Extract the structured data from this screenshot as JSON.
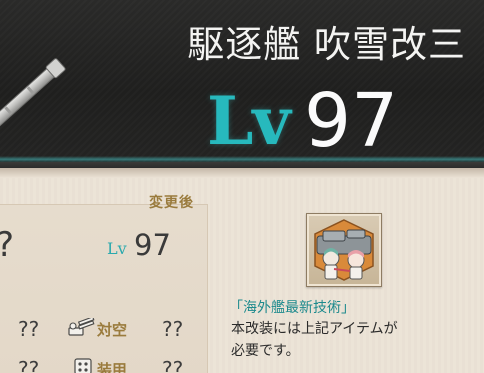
{
  "header": {
    "ship_title": "駆逐艦 吹雪改三",
    "level_prefix": "Lv",
    "level_value": "97"
  },
  "card": {
    "after_label": "変更後",
    "unknown_name": "?",
    "level_prefix": "Lv",
    "level_value": "97",
    "stats": [
      {
        "left_value": "??",
        "name": "対空",
        "right_value": "??",
        "icon": "anti-air-gun-icon"
      },
      {
        "left_value": "??",
        "name": "装甲",
        "right_value": "??",
        "icon": "armor-icon"
      }
    ]
  },
  "requirement": {
    "item_icon": "foreign-ship-tech-blueprint-icon",
    "item_name": "「海外艦最新技術」",
    "desc_line1": "本改装には上記アイテムが",
    "desc_line2": "必要です。"
  },
  "colors": {
    "banner_bg": "#222221",
    "level_accent": "#27b9bd",
    "label_gold": "#9a7b3d",
    "item_name_teal": "#1d8a8d",
    "panel_bg": "#ece3d6"
  }
}
